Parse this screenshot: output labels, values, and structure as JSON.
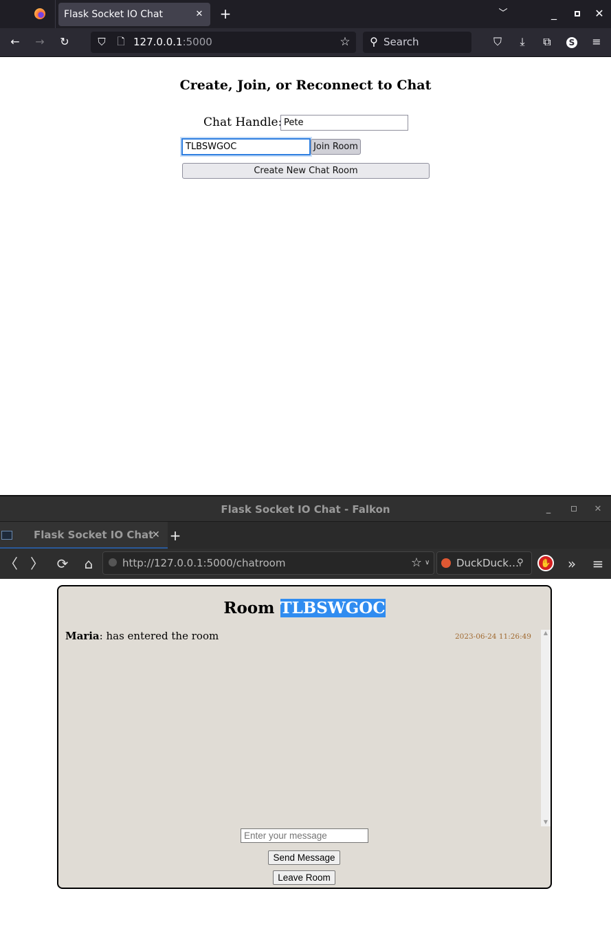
{
  "firefox": {
    "tab_title": "Flask Socket IO Chat",
    "url_host": "127.0.0.1",
    "url_port": ":5000",
    "search_placeholder": "Search"
  },
  "join_page": {
    "heading": "Create, Join, or Reconnect to Chat",
    "handle_label": "Chat Handle:",
    "handle_value": "Pete",
    "room_code_value": "TLBSWGOC",
    "join_button": "Join Room",
    "create_button": "Create New Chat Room"
  },
  "falkon": {
    "window_title": "Flask Socket IO Chat - Falkon",
    "tab_title": "Flask Socket IO Chat",
    "url": "http://127.0.0.1:5000/chatroom",
    "search_engine": "DuckDuck…"
  },
  "chatroom": {
    "room_label": "Room",
    "room_code": "TLBSWGOC",
    "messages": [
      {
        "user": "Maria",
        "text": ": has entered the room",
        "timestamp": "2023-06-24 11:26:49"
      }
    ],
    "message_placeholder": "Enter your message",
    "send_button": "Send Message",
    "leave_button": "Leave Room"
  },
  "colors": {
    "selection": "#308cf0",
    "chat_bg": "#e0dcd5",
    "timestamp": "#a0692f"
  }
}
